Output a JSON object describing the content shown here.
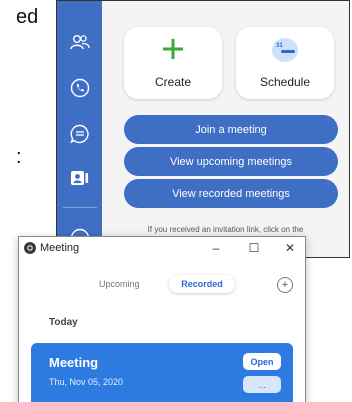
{
  "background_doc": {
    "fragments": [
      "ed",
      "",
      ":"
    ]
  },
  "teams": {
    "rail": {
      "accent": "#3f6fc4",
      "icons": [
        "people-icon",
        "phone-icon",
        "chat-icon",
        "contact-card-icon"
      ]
    },
    "tiles": {
      "create_label": "Create",
      "schedule_label": "Schedule",
      "calendar_number": "31"
    },
    "actions": {
      "join": "Join a meeting",
      "upcoming": "View upcoming meetings",
      "recorded": "View recorded meetings"
    },
    "hint": "If you received an invitation link, click on the"
  },
  "meeting_window": {
    "title": "Meeting",
    "controls": {
      "minimize": "–",
      "maximize": "☐",
      "close": "✕"
    },
    "tabs": {
      "upcoming": "Upcoming",
      "recorded": "Recorded"
    },
    "add": "+",
    "section": "Today",
    "card": {
      "title": "Meeting",
      "date": "Thu, Nov 05, 2020",
      "open_label": "Open",
      "more_label": "..."
    },
    "accent": "#2d7be0"
  }
}
